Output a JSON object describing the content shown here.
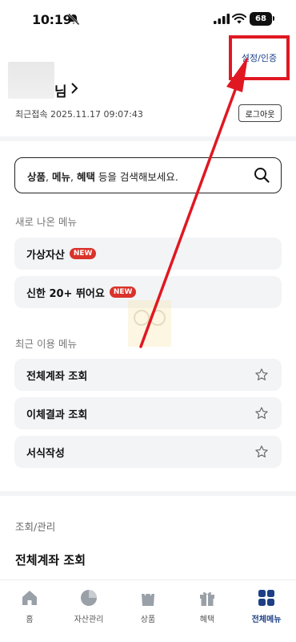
{
  "status_bar": {
    "time": "10:19",
    "battery": "68"
  },
  "header": {
    "settings_label": "설정/인증",
    "user_suffix": "님",
    "last_login_label": "최근접속",
    "last_login_time": "2025.11.17 09:07:43",
    "logout_label": "로그아웃"
  },
  "search": {
    "kw1": "상품",
    "sep1": ", ",
    "kw2": "메뉴",
    "sep2": ", ",
    "kw3": "혜택",
    "rest": " 등을 검색해보세요."
  },
  "new_menus": {
    "title": "새로 나온 메뉴",
    "badge": "NEW",
    "items": [
      {
        "label": "가상자산"
      },
      {
        "label": "신한 20+ 뛰어요"
      }
    ]
  },
  "recent_menus": {
    "title": "최근 이용 메뉴",
    "items": [
      {
        "label": "전체계좌 조회"
      },
      {
        "label": "이체결과 조회"
      },
      {
        "label": "서식작성"
      }
    ]
  },
  "inquiry": {
    "title": "조회/관리",
    "first_item": "전체계좌 조회"
  },
  "tab_bar": {
    "tabs": [
      {
        "label": "홈",
        "icon": "home-icon"
      },
      {
        "label": "자산관리",
        "icon": "pie-chart-icon"
      },
      {
        "label": "상품",
        "icon": "shopping-bag-icon"
      },
      {
        "label": "혜택",
        "icon": "gift-icon"
      },
      {
        "label": "전체메뉴",
        "icon": "grid-icon",
        "active": true
      }
    ]
  },
  "colors": {
    "highlight_red": "#e01822",
    "brand_navy": "#1d3f86",
    "new_badge": "#d9332b",
    "pill_bg": "#f3f4f6"
  }
}
